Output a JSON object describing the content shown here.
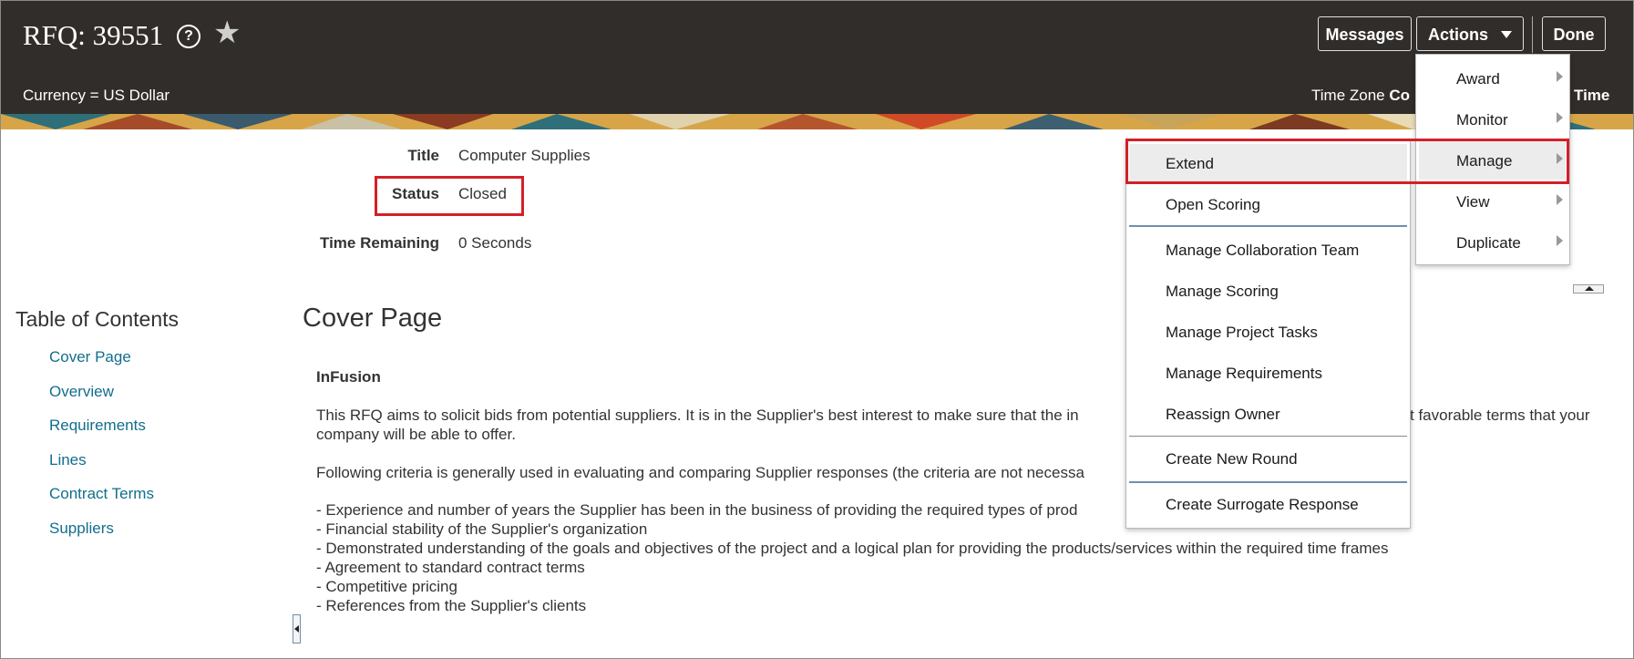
{
  "header": {
    "title": "RFQ: 39551",
    "currency": "Currency = US Dollar",
    "time_zone_label": "Time Zone",
    "time_zone_value": "Co",
    "time_zone_end": "Time",
    "buttons": {
      "messages": "Messages",
      "actions": "Actions",
      "done": "Done"
    }
  },
  "info": {
    "title_label": "Title",
    "title_value": "Computer Supplies",
    "status_label": "Status",
    "status_value": "Closed",
    "time_remaining_label": "Time Remaining",
    "time_remaining_value": "0 Seconds"
  },
  "toc": {
    "heading": "Table of Contents",
    "items": [
      "Cover Page",
      "Overview",
      "Requirements",
      "Lines",
      "Contract Terms",
      "Suppliers"
    ]
  },
  "cover": {
    "heading": "Cover Page",
    "org": "InFusion",
    "para1_line1": "This RFQ aims to solicit bids from potential suppliers. It is in the Supplier's best interest to make sure that the in",
    "para1_line1_end": "t favorable terms that your",
    "para1_line2": "company will be able to offer.",
    "para2": "Following criteria is generally used in evaluating and comparing Supplier responses (the criteria are not necessa",
    "bullets": [
      "-  Experience and number of years the Supplier has been in the business of providing the required types of prod",
      "-  Financial stability of the Supplier's organization",
      "-  Demonstrated understanding of the goals and objectives of the project and a logical plan for providing the products/services within the required time frames",
      "-  Agreement to standard contract terms",
      "-  Competitive pricing",
      "-  References from the Supplier's clients"
    ]
  },
  "actions_menu": {
    "items": [
      "Award",
      "Monitor",
      "Manage",
      "View",
      "Duplicate"
    ]
  },
  "manage_menu": {
    "items": [
      "Extend",
      "Open Scoring",
      "Manage Collaboration Team",
      "Manage Scoring",
      "Manage Project Tasks",
      "Manage Requirements",
      "Reassign Owner",
      "Create New Round",
      "Create Surrogate Response"
    ]
  },
  "colors": {
    "header_bg": "#312d2a",
    "link": "#116e8c",
    "highlight": "#d32028"
  }
}
